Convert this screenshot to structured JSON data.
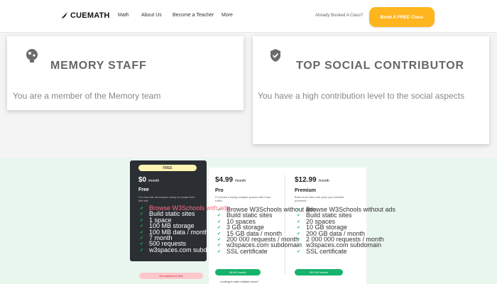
{
  "nav": {
    "logo": "CUEMATH",
    "links": [
      "Math",
      "About Us",
      "Become a Teacher",
      "More"
    ],
    "booked_text": "Already Booked A Class?",
    "cta": "Book A FREE Class"
  },
  "badges": [
    {
      "title": "MEMORY STAFF",
      "description": "You are a member of the Memory team",
      "icon": "memory-icon"
    },
    {
      "title": "TOP SOCIAL CONTRIBUTOR",
      "description": "You have a high contribution level to the social aspects",
      "icon": "shield-check-icon"
    }
  ],
  "plans": {
    "free": {
      "pill": "FREE",
      "price": "$0",
      "per": "/month",
      "name": "Free",
      "desc": "For new site developers ready to create their first site.",
      "features": [
        "Browse W3Schools with ads",
        "Build static sites",
        "1 space",
        "100 MB storage",
        "100 MB data / month",
        "7 month",
        "500 requests",
        "w3spaces.com subdomain"
      ],
      "button": "Get started for free"
    },
    "pro": {
      "price": "$4.99",
      "per": "/month",
      "name": "Pro",
      "desc": "For those running multiple spaces with more traffic.",
      "features": [
        "Browse W3Schools without ads",
        "Build static sites",
        "10 spaces",
        "3 GB storage",
        "15 GB data / month",
        "200 000 requests / month",
        "w3spaces.com subdomain",
        "SSL certificate"
      ],
      "button": "$4.99 /month"
    },
    "premium": {
      "price": "$12.99",
      "per": "/month",
      "name": "Premium",
      "desc": "Build more sites and grow your website presence.",
      "features": [
        "Browse W3Schools without ads",
        "Build static sites",
        "20 spaces",
        "10 GB storage",
        "200 GB data / month",
        "2 000 000 requests / month",
        "w3spaces.com subdomain",
        "SSL certificate"
      ],
      "button": "$12.99 /month"
    }
  },
  "more_note": "Looking to add multiple users?",
  "colors": {
    "accent": "#ffb51e",
    "green": "#16b36a",
    "free_card": "#2b2f33",
    "section_bg": "#e9f6ee"
  }
}
